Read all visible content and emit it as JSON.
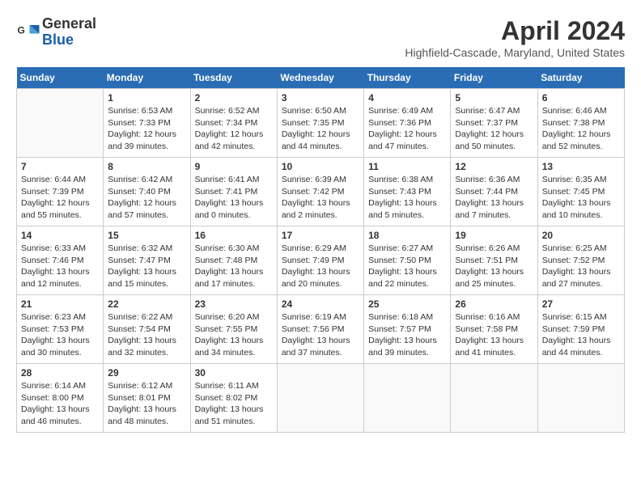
{
  "header": {
    "logo_general": "General",
    "logo_blue": "Blue",
    "month_title": "April 2024",
    "location": "Highfield-Cascade, Maryland, United States"
  },
  "days_of_week": [
    "Sunday",
    "Monday",
    "Tuesday",
    "Wednesday",
    "Thursday",
    "Friday",
    "Saturday"
  ],
  "weeks": [
    [
      {
        "day": "",
        "info": ""
      },
      {
        "day": "1",
        "info": "Sunrise: 6:53 AM\nSunset: 7:33 PM\nDaylight: 12 hours\nand 39 minutes."
      },
      {
        "day": "2",
        "info": "Sunrise: 6:52 AM\nSunset: 7:34 PM\nDaylight: 12 hours\nand 42 minutes."
      },
      {
        "day": "3",
        "info": "Sunrise: 6:50 AM\nSunset: 7:35 PM\nDaylight: 12 hours\nand 44 minutes."
      },
      {
        "day": "4",
        "info": "Sunrise: 6:49 AM\nSunset: 7:36 PM\nDaylight: 12 hours\nand 47 minutes."
      },
      {
        "day": "5",
        "info": "Sunrise: 6:47 AM\nSunset: 7:37 PM\nDaylight: 12 hours\nand 50 minutes."
      },
      {
        "day": "6",
        "info": "Sunrise: 6:46 AM\nSunset: 7:38 PM\nDaylight: 12 hours\nand 52 minutes."
      }
    ],
    [
      {
        "day": "7",
        "info": "Sunrise: 6:44 AM\nSunset: 7:39 PM\nDaylight: 12 hours\nand 55 minutes."
      },
      {
        "day": "8",
        "info": "Sunrise: 6:42 AM\nSunset: 7:40 PM\nDaylight: 12 hours\nand 57 minutes."
      },
      {
        "day": "9",
        "info": "Sunrise: 6:41 AM\nSunset: 7:41 PM\nDaylight: 13 hours\nand 0 minutes."
      },
      {
        "day": "10",
        "info": "Sunrise: 6:39 AM\nSunset: 7:42 PM\nDaylight: 13 hours\nand 2 minutes."
      },
      {
        "day": "11",
        "info": "Sunrise: 6:38 AM\nSunset: 7:43 PM\nDaylight: 13 hours\nand 5 minutes."
      },
      {
        "day": "12",
        "info": "Sunrise: 6:36 AM\nSunset: 7:44 PM\nDaylight: 13 hours\nand 7 minutes."
      },
      {
        "day": "13",
        "info": "Sunrise: 6:35 AM\nSunset: 7:45 PM\nDaylight: 13 hours\nand 10 minutes."
      }
    ],
    [
      {
        "day": "14",
        "info": "Sunrise: 6:33 AM\nSunset: 7:46 PM\nDaylight: 13 hours\nand 12 minutes."
      },
      {
        "day": "15",
        "info": "Sunrise: 6:32 AM\nSunset: 7:47 PM\nDaylight: 13 hours\nand 15 minutes."
      },
      {
        "day": "16",
        "info": "Sunrise: 6:30 AM\nSunset: 7:48 PM\nDaylight: 13 hours\nand 17 minutes."
      },
      {
        "day": "17",
        "info": "Sunrise: 6:29 AM\nSunset: 7:49 PM\nDaylight: 13 hours\nand 20 minutes."
      },
      {
        "day": "18",
        "info": "Sunrise: 6:27 AM\nSunset: 7:50 PM\nDaylight: 13 hours\nand 22 minutes."
      },
      {
        "day": "19",
        "info": "Sunrise: 6:26 AM\nSunset: 7:51 PM\nDaylight: 13 hours\nand 25 minutes."
      },
      {
        "day": "20",
        "info": "Sunrise: 6:25 AM\nSunset: 7:52 PM\nDaylight: 13 hours\nand 27 minutes."
      }
    ],
    [
      {
        "day": "21",
        "info": "Sunrise: 6:23 AM\nSunset: 7:53 PM\nDaylight: 13 hours\nand 30 minutes."
      },
      {
        "day": "22",
        "info": "Sunrise: 6:22 AM\nSunset: 7:54 PM\nDaylight: 13 hours\nand 32 minutes."
      },
      {
        "day": "23",
        "info": "Sunrise: 6:20 AM\nSunset: 7:55 PM\nDaylight: 13 hours\nand 34 minutes."
      },
      {
        "day": "24",
        "info": "Sunrise: 6:19 AM\nSunset: 7:56 PM\nDaylight: 13 hours\nand 37 minutes."
      },
      {
        "day": "25",
        "info": "Sunrise: 6:18 AM\nSunset: 7:57 PM\nDaylight: 13 hours\nand 39 minutes."
      },
      {
        "day": "26",
        "info": "Sunrise: 6:16 AM\nSunset: 7:58 PM\nDaylight: 13 hours\nand 41 minutes."
      },
      {
        "day": "27",
        "info": "Sunrise: 6:15 AM\nSunset: 7:59 PM\nDaylight: 13 hours\nand 44 minutes."
      }
    ],
    [
      {
        "day": "28",
        "info": "Sunrise: 6:14 AM\nSunset: 8:00 PM\nDaylight: 13 hours\nand 46 minutes."
      },
      {
        "day": "29",
        "info": "Sunrise: 6:12 AM\nSunset: 8:01 PM\nDaylight: 13 hours\nand 48 minutes."
      },
      {
        "day": "30",
        "info": "Sunrise: 6:11 AM\nSunset: 8:02 PM\nDaylight: 13 hours\nand 51 minutes."
      },
      {
        "day": "",
        "info": ""
      },
      {
        "day": "",
        "info": ""
      },
      {
        "day": "",
        "info": ""
      },
      {
        "day": "",
        "info": ""
      }
    ]
  ]
}
